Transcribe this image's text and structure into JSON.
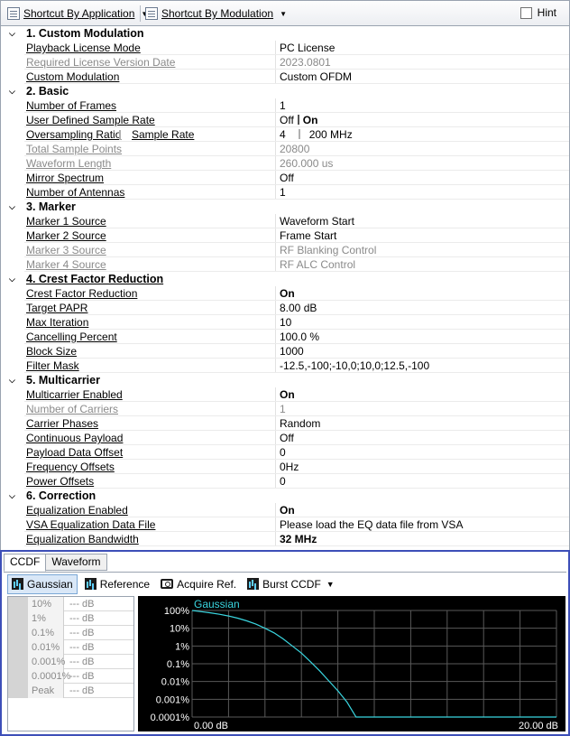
{
  "toolbar": {
    "shortcut_app": "Shortcut By Application",
    "shortcut_mod": "Shortcut By Modulation",
    "hint": "Hint"
  },
  "grid": {
    "cat1": {
      "title": "1. Custom Modulation",
      "r1": {
        "name": "Playback License Mode",
        "value": "PC License"
      },
      "r2": {
        "name": "Required License Version Date",
        "value": "2023.0801"
      },
      "r3": {
        "name": "Custom Modulation",
        "value": "Custom OFDM"
      }
    },
    "cat2": {
      "title": "2. Basic",
      "r1": {
        "name": "Number of Frames",
        "value": "1"
      },
      "r2": {
        "name": "User Defined Sample Rate",
        "off": "Off",
        "on": "On"
      },
      "r3": {
        "name": "Oversampling Ratio",
        "name2": "Sample Rate",
        "value": "4",
        "value2": "200 MHz"
      },
      "r4": {
        "name": "Total Sample Points",
        "value": "20800"
      },
      "r5": {
        "name": "Waveform Length",
        "value": "260.000 us"
      },
      "r6": {
        "name": "Mirror Spectrum",
        "value": "Off"
      },
      "r7": {
        "name": "Number of Antennas",
        "value": "1"
      }
    },
    "cat3": {
      "title": "3. Marker",
      "r1": {
        "name": "Marker 1 Source",
        "value": "Waveform Start"
      },
      "r2": {
        "name": "Marker 2 Source",
        "value": "Frame Start"
      },
      "r3": {
        "name": "Marker 3 Source",
        "value": "RF Blanking Control"
      },
      "r4": {
        "name": "Marker 4 Source",
        "value": "RF ALC Control"
      }
    },
    "cat4": {
      "title": "4. Crest Factor Reduction",
      "r1": {
        "name": "Crest Factor Reduction",
        "value": "On"
      },
      "r2": {
        "name": "Target PAPR",
        "value": "8.00 dB"
      },
      "r3": {
        "name": "Max Iteration",
        "value": "10"
      },
      "r4": {
        "name": "Cancelling Percent",
        "value": "100.0 %"
      },
      "r5": {
        "name": "Block Size",
        "value": "1000"
      },
      "r6": {
        "name": "Filter Mask",
        "value": "-12.5,-100;-10,0;10,0;12.5,-100"
      }
    },
    "cat5": {
      "title": "5. Multicarrier",
      "r1": {
        "name": "Multicarrier Enabled",
        "value": "On"
      },
      "r2": {
        "name": "Number of Carriers",
        "value": "1"
      },
      "r3": {
        "name": "Carrier Phases",
        "value": "Random"
      },
      "r4": {
        "name": "Continuous Payload",
        "value": "Off"
      },
      "r5": {
        "name": "Payload Data Offset",
        "value": "0"
      },
      "r6": {
        "name": "Frequency Offsets",
        "value": "0Hz"
      },
      "r7": {
        "name": "Power Offsets",
        "value": "0"
      }
    },
    "cat6": {
      "title": "6. Correction",
      "r1": {
        "name": "Equalization Enabled",
        "value": "On"
      },
      "r2": {
        "name": "VSA Equalization Data File",
        "value": "Please load the EQ data file from VSA"
      },
      "r3": {
        "name": "Equalization Bandwidth",
        "value": "32 MHz"
      }
    }
  },
  "panel": {
    "tabs": [
      "CCDF",
      "Waveform"
    ],
    "buttons": {
      "gaussian": "Gaussian",
      "reference": "Reference",
      "acquire": "Acquire Ref.",
      "burst": "Burst CCDF"
    },
    "stats": [
      {
        "k": "10%",
        "v": "--- dB"
      },
      {
        "k": "1%",
        "v": "--- dB"
      },
      {
        "k": "0.1%",
        "v": "--- dB"
      },
      {
        "k": "0.01%",
        "v": "--- dB"
      },
      {
        "k": "0.001%",
        "v": "--- dB"
      },
      {
        "k": "0.0001%",
        "v": "--- dB"
      },
      {
        "k": "Peak",
        "v": "--- dB"
      }
    ]
  },
  "colors": {
    "trace": "#3ad6e0",
    "chart_bg": "#000000",
    "grid": "#5a5a5a"
  },
  "chart_data": {
    "type": "line",
    "title": "",
    "series": [
      {
        "name": "Gaussian",
        "x": [
          0,
          0.5,
          1,
          1.5,
          2,
          2.5,
          3,
          3.5,
          4,
          4.5,
          5,
          5.5,
          6,
          6.5,
          7,
          7.5,
          8,
          8.5,
          9,
          20
        ],
        "y": [
          100,
          86,
          74,
          61,
          49,
          37,
          26,
          17,
          10,
          5.5,
          2.5,
          1.0,
          0.4,
          0.13,
          0.04,
          0.011,
          0.003,
          0.0007,
          0.0001,
          0.0001
        ]
      }
    ],
    "x_tick_labels": [
      "0.00 dB",
      "20.00 dB"
    ],
    "y_tick_labels": [
      "100%",
      "10%",
      "1%",
      "0.1%",
      "0.01%",
      "0.001%",
      "0.0001%"
    ],
    "xlim": [
      0,
      20
    ],
    "ylim": [
      0.0001,
      100
    ],
    "yscale": "log",
    "grid": true,
    "legend": "top-left"
  }
}
